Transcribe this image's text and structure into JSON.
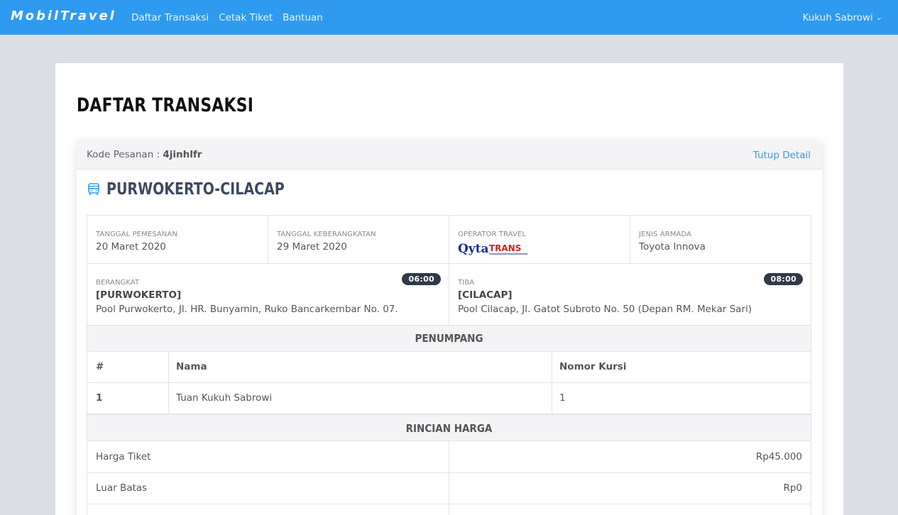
{
  "navbar": {
    "brand": "MobilTravel",
    "links": [
      "Daftar Transaksi",
      "Cetak Tiket",
      "Bantuan"
    ],
    "user": "Kukuh Sabrowi"
  },
  "page": {
    "title": "DAFTAR TRANSAKSI"
  },
  "order": {
    "code_label": "Kode Pesanan :",
    "code_value": "4jinhlfr",
    "close_label": "Tutup Detail",
    "route": "PURWOKERTO-CILACAP"
  },
  "info": {
    "booking_date_label": "TANGGAL PEMESANAN",
    "booking_date": "20 Maret 2020",
    "departure_date_label": "TANGGAL KEBERANGKATAN",
    "departure_date": "29 Maret 2020",
    "operator_label": "OPERATOR TRAVEL",
    "operator_logo_text": "Qyta TRANS",
    "fleet_label": "JENIS ARMADA",
    "fleet": "Toyota Innova"
  },
  "departure": {
    "label": "BERANGKAT",
    "time": "06:00",
    "city": "[PURWOKERTO]",
    "address": "Pool Purwokerto, Jl. HR. Bunyamin, Ruko Bancarkembar No. 07."
  },
  "arrival": {
    "label": "TIBA",
    "time": "08:00",
    "city": "[CILACAP]",
    "address": "Pool Cilacap, Jl. Gatot Subroto No. 50 (Depan RM. Mekar Sari)"
  },
  "passengers": {
    "section_title": "PENUMPANG",
    "headers": [
      "#",
      "Nama",
      "Nomor Kursi"
    ],
    "rows": [
      [
        "1",
        "Tuan Kukuh Sabrowi",
        "1"
      ]
    ]
  },
  "pricing": {
    "section_title": "RINCIAN HARGA",
    "rows": [
      {
        "label": "Harga Tiket",
        "value": "Rp45.000"
      },
      {
        "label": "Luar Batas",
        "value": "Rp0"
      }
    ]
  },
  "colors": {
    "navbar": "#2e9bf0",
    "accent": "#2e9bf0",
    "badge": "#2f3a48"
  }
}
